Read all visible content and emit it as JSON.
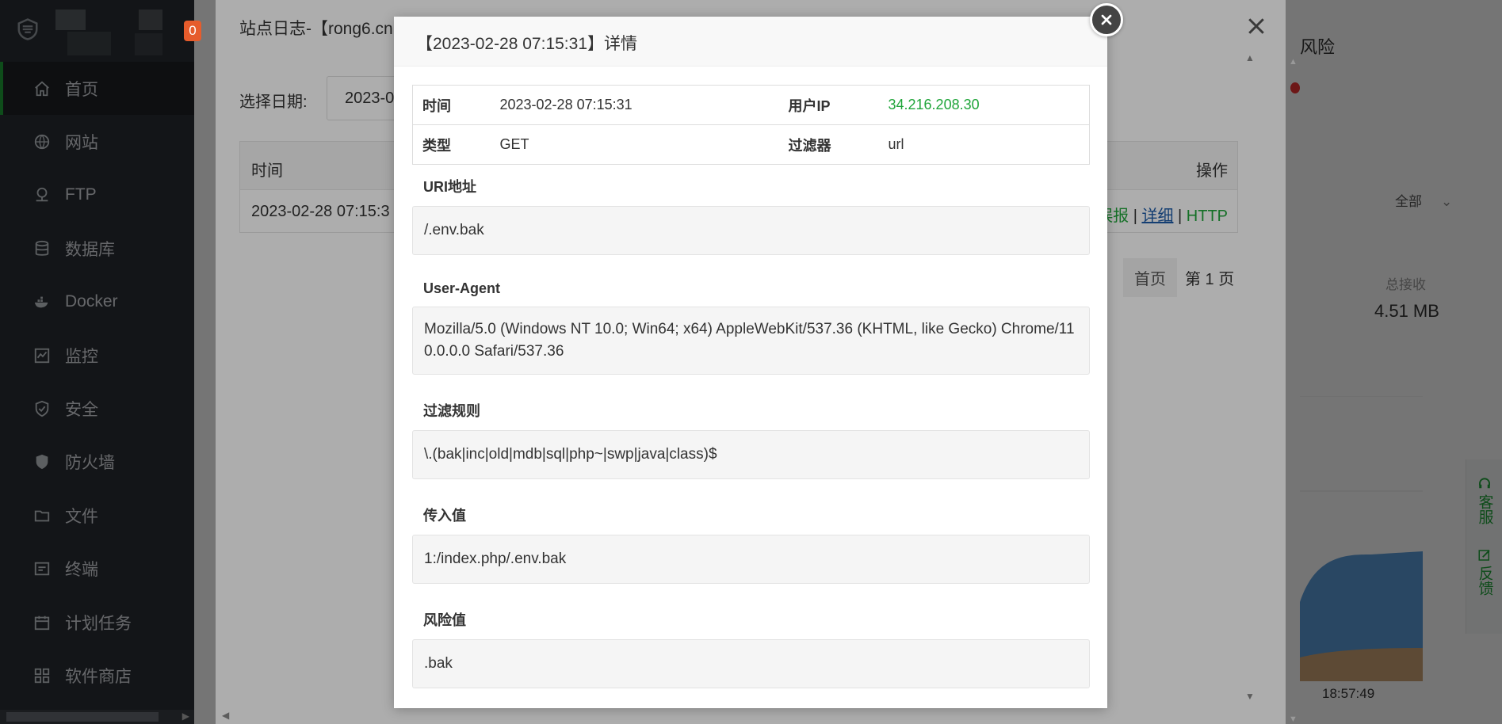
{
  "sidebar": {
    "badge": "0",
    "items": [
      {
        "label": "首页",
        "icon": "home-icon",
        "active": true
      },
      {
        "label": "网站",
        "icon": "globe-icon"
      },
      {
        "label": "FTP",
        "icon": "ftp-icon"
      },
      {
        "label": "数据库",
        "icon": "database-icon"
      },
      {
        "label": "Docker",
        "icon": "docker-icon"
      },
      {
        "label": "监控",
        "icon": "monitor-icon"
      },
      {
        "label": "安全",
        "icon": "shield-check-icon"
      },
      {
        "label": "防火墙",
        "icon": "shield-icon"
      },
      {
        "label": "文件",
        "icon": "folder-icon"
      },
      {
        "label": "终端",
        "icon": "terminal-icon"
      },
      {
        "label": "计划任务",
        "icon": "calendar-icon"
      },
      {
        "label": "软件商店",
        "icon": "grid-icon"
      }
    ]
  },
  "background": {
    "risk_text": "风险",
    "select_label": "全部",
    "total_label": "总接收",
    "total_value": "4.51 MB",
    "chart_time": "18:57:49",
    "float_service": "客服",
    "float_feedback": "反馈"
  },
  "site_log_dialog": {
    "title": "站点日志-【rong6.cn",
    "date_label": "选择日期:",
    "date_value": "2023-0",
    "col_time": "时间",
    "col_action": "操作",
    "row_time": "2023-02-28 07:15:3",
    "link_report": "误报",
    "link_detail": "详细",
    "link_http": "HTTP",
    "link_sep": "|",
    "pager_first": "首页",
    "pager_current": "第 1 页"
  },
  "detail_dialog": {
    "title": "【2023-02-28 07:15:31】详情",
    "time_label": "时间",
    "time_value": "2023-02-28 07:15:31",
    "ip_label": "用户IP",
    "ip_value": "34.216.208.30",
    "type_label": "类型",
    "type_value": "GET",
    "filter_label": "过滤器",
    "filter_value": "url",
    "uri_label": "URI地址",
    "uri_value": "/.env.bak",
    "ua_label": "User-Agent",
    "ua_value": "Mozilla/5.0 (Windows NT 10.0; Win64; x64) AppleWebKit/537.36 (KHTML, like Gecko) Chrome/110.0.0.0 Safari/537.36",
    "rule_label": "过滤规则",
    "rule_value": "\\.(bak|inc|old|mdb|sql|php~|swp|java|class)$",
    "input_label": "传入值",
    "input_value": "1:/index.php/.env.bak",
    "risk_label": "风险值",
    "risk_value": ".bak"
  }
}
